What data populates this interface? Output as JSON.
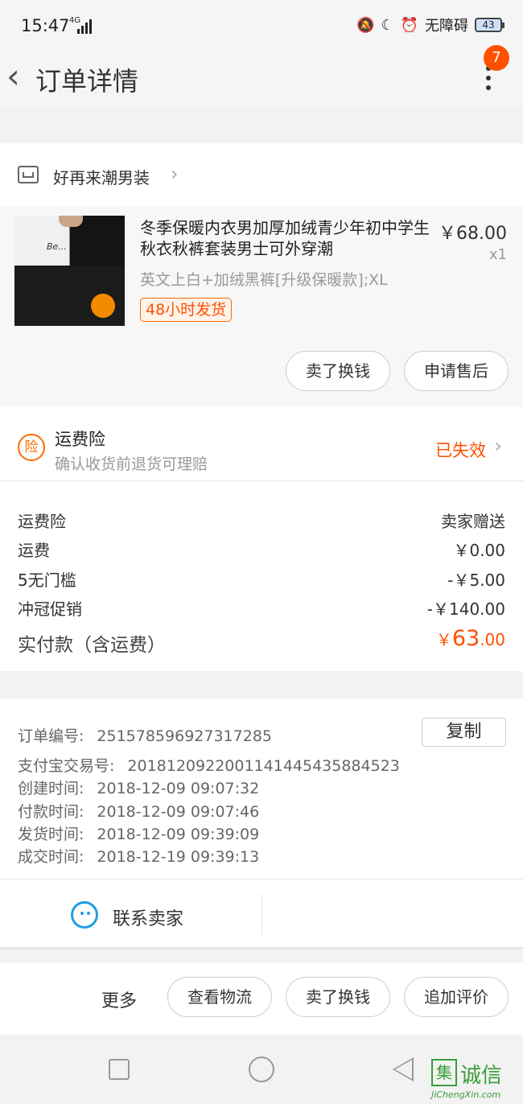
{
  "status_bar": {
    "time": "15:47",
    "network": "4G",
    "accessibility": "无障碍",
    "battery": "43"
  },
  "nav": {
    "title": "订单详情",
    "badge": "7"
  },
  "shop": {
    "name": "好再来潮男装"
  },
  "product": {
    "name": "冬季保暖内衣男加厚加绒青少年初中学生秋衣秋裤套装男士可外穿潮",
    "price": "￥68.00",
    "qty": "x1",
    "spec": "英文上白+加绒黑裤[升级保暖款];XL",
    "tag": "48小时发货",
    "buttons": [
      "卖了换钱",
      "申请售后"
    ]
  },
  "insurance": {
    "icon_char": "险",
    "title": "运费险",
    "subtitle": "确认收货前退货可理赔",
    "status": "已失效"
  },
  "fees": [
    {
      "label": "运费险",
      "value": "卖家赠送"
    },
    {
      "label": "运费",
      "value": "￥0.00"
    },
    {
      "label": "5无门槛",
      "value": "-￥5.00"
    },
    {
      "label": "冲冠促销",
      "value": "-￥140.00"
    }
  ],
  "total": {
    "label": "实付款（含运费）",
    "currency": "￥",
    "integer": "63",
    "decimal": ".00"
  },
  "order_info": {
    "copy_label": "复制",
    "rows": [
      {
        "key": "订单编号:",
        "value": "251578596927317285"
      },
      {
        "key": "支付宝交易号:",
        "value": "2018120922001141445435884523"
      },
      {
        "key": "创建时间:",
        "value": "2018-12-09 09:07:32"
      },
      {
        "key": "付款时间:",
        "value": "2018-12-09 09:07:46"
      },
      {
        "key": "发货时间:",
        "value": "2018-12-09 09:39:09"
      },
      {
        "key": "成交时间:",
        "value": "2018-12-19 09:39:13"
      }
    ]
  },
  "contact": {
    "label": "联系卖家"
  },
  "actions": {
    "more": "更多",
    "buttons": [
      "查看物流",
      "卖了换钱",
      "追加评价"
    ]
  },
  "watermark": {
    "seal": "集",
    "cn": "诚信",
    "en": "JiChengXin.com"
  },
  "colors": {
    "accent": "#ff5000",
    "contact_blue": "#1e9fe6"
  }
}
